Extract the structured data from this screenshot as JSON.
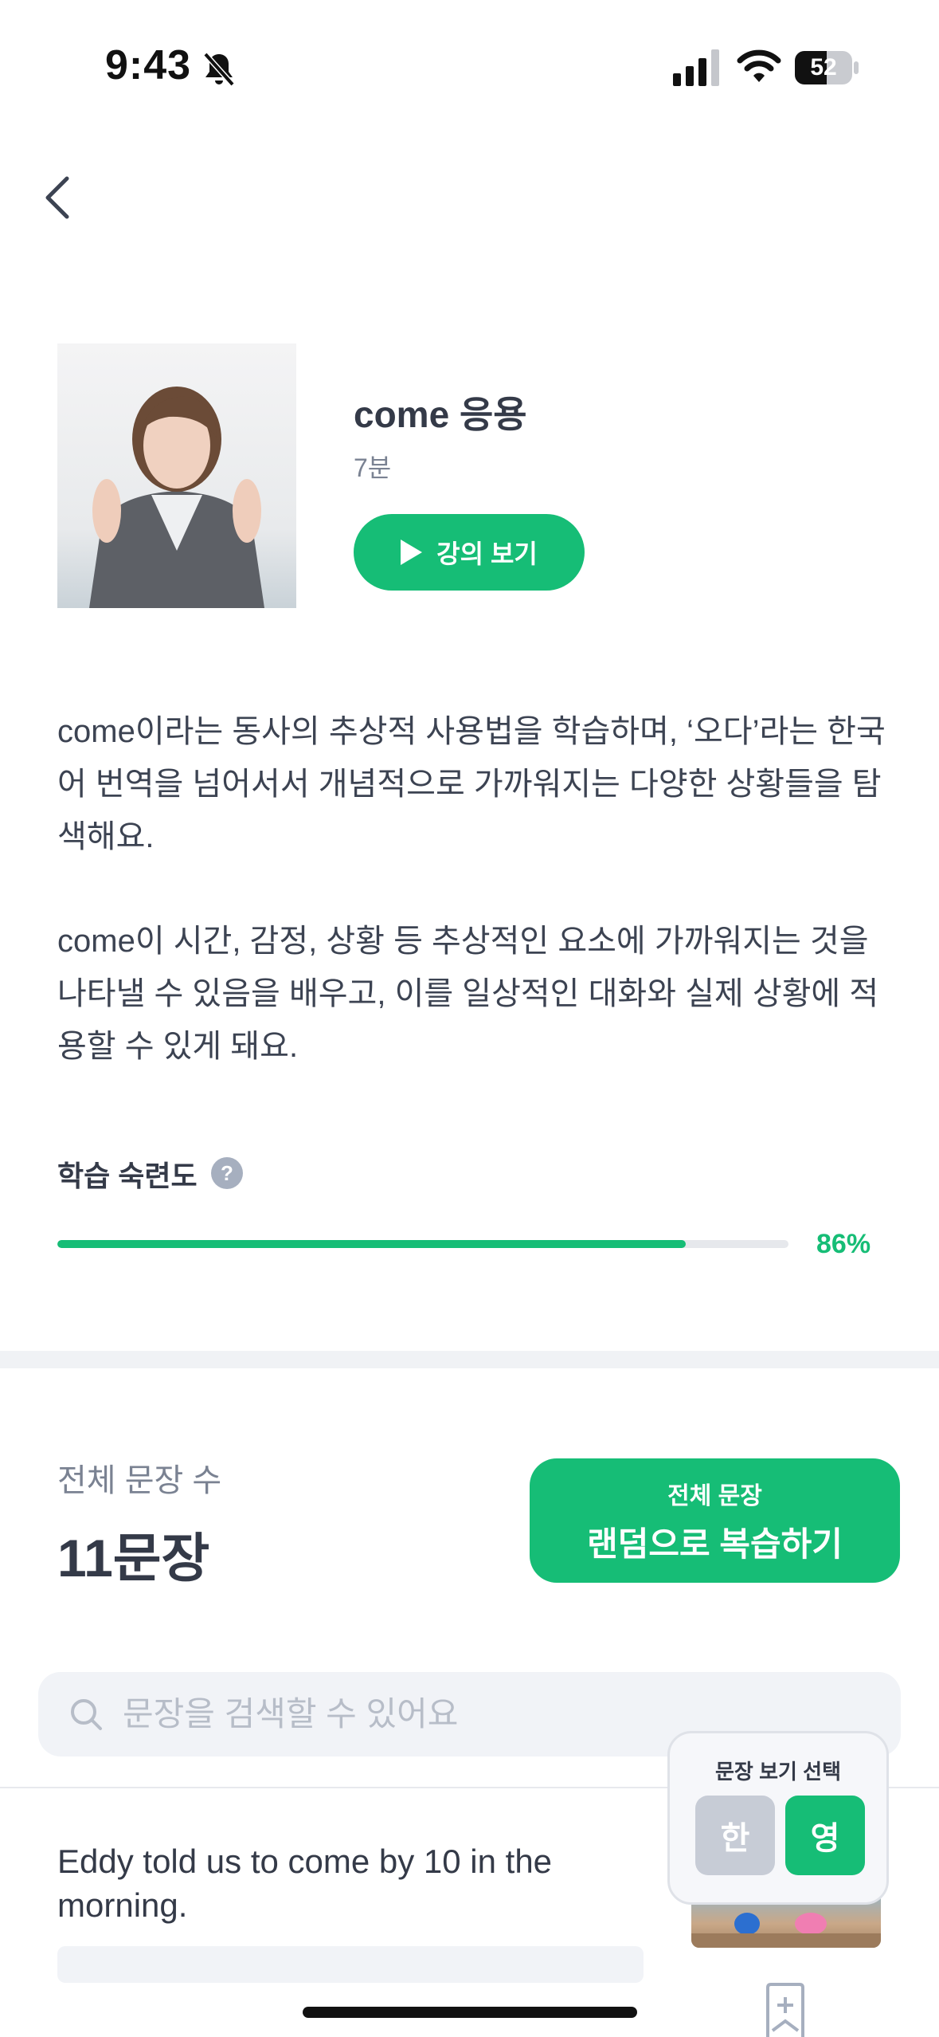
{
  "status_bar": {
    "time": "9:43",
    "battery": "52"
  },
  "lecture": {
    "title": "come 응용",
    "duration": "7분",
    "watch_label": "강의 보기"
  },
  "description": [
    "come이라는 동사의 추상적 사용법을 학습하며, ‘오다’라는 한국어 번역을 넘어서서 개념적으로 가까워지는 다양한 상황들을 탐색해요.",
    "come이 시간, 감정, 상황 등 추상적인 요소에 가까워지는 것을 나타낼 수 있음을 배우고, 이를 일상적인 대화와 실제 상황에 적용할 수 있게 돼요."
  ],
  "mastery": {
    "label": "학습 숙련도",
    "help": "?",
    "percent_text": "86%",
    "value": 0.86
  },
  "sentences": {
    "count_label": "전체 문장 수",
    "count_value": "11문장",
    "review_top": "전체 문장",
    "review_main": "랜덤으로 복습하기"
  },
  "search": {
    "placeholder": "문장을 검색할 수 있어요"
  },
  "view_toggle": {
    "title": "문장 보기 선택",
    "korean": "한",
    "english": "영",
    "selected": "english"
  },
  "sentence_list": [
    {
      "text": "Eddy told us to come by 10 in the morning."
    }
  ],
  "colors": {
    "accent": "#16bd76",
    "text": "#343a48",
    "muted": "#7a8292"
  }
}
